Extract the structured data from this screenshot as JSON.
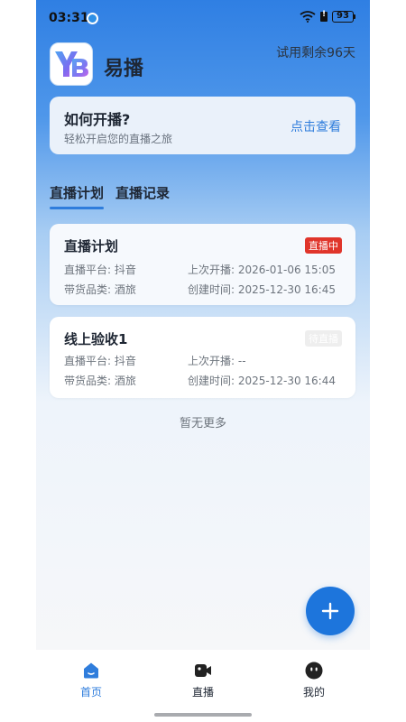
{
  "status_bar": {
    "time": "03:31",
    "battery": "93"
  },
  "header": {
    "logo_text": "YB",
    "app_name": "易播",
    "trial_text": "试用剩余96天"
  },
  "help_card": {
    "title": "如何开播?",
    "subtitle": "轻松开启您的直播之旅",
    "link": "点击查看"
  },
  "tabs": [
    {
      "label": "直播计划",
      "active": true
    },
    {
      "label": "直播记录",
      "active": false
    }
  ],
  "plans": [
    {
      "name": "直播计划",
      "status": "直播中",
      "platform": "直播平台: 抖音",
      "last_live": "上次开播: 2026-01-06 15:05",
      "category": "带货品类: 酒旅",
      "created": "创建时间: 2025-12-30 16:45"
    },
    {
      "name": "线上验收1",
      "status": "待直播",
      "platform": "直播平台: 抖音",
      "last_live": "上次开播: --",
      "category": "带货品类: 酒旅",
      "created": "创建时间: 2025-12-30 16:44"
    }
  ],
  "list_end_text": "暂无更多",
  "fab": {
    "icon": "plus-icon"
  },
  "bottom_nav": [
    {
      "label": "首页",
      "icon": "home-icon",
      "active": true
    },
    {
      "label": "直播",
      "icon": "video-camera-icon",
      "active": false
    },
    {
      "label": "我的",
      "icon": "profile-face-icon",
      "active": false
    }
  ],
  "colors": {
    "accent": "#2f7ddc",
    "live_badge": "#e0352b",
    "waiting_badge": "#eeeeee",
    "fab": "#1d75dc"
  }
}
